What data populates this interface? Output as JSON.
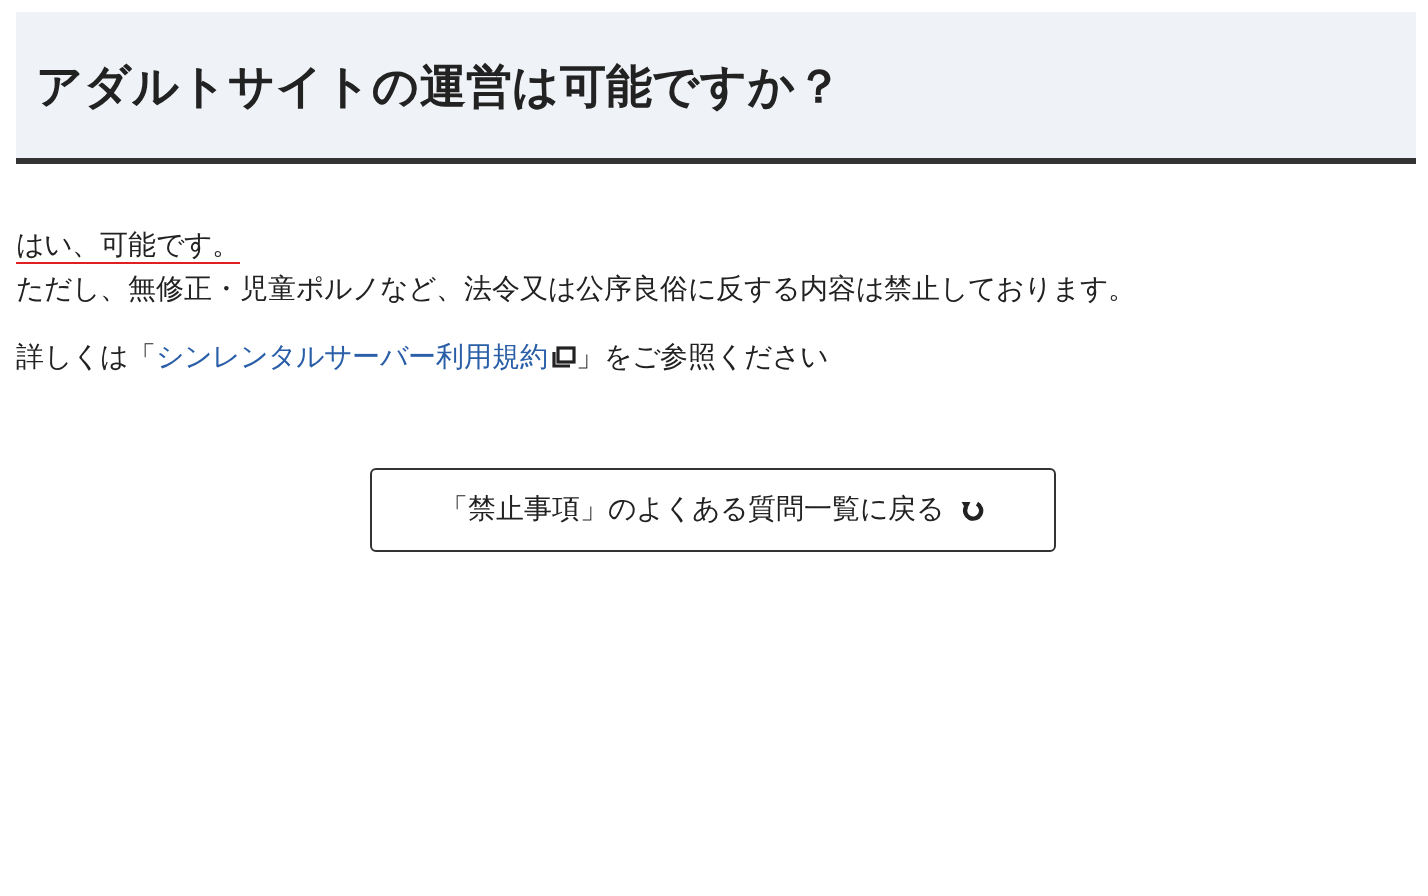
{
  "heading": "アダルトサイトの運営は可能ですか？",
  "answer_lines": [
    {
      "text": "はい、可能です。",
      "emphasized": true
    },
    {
      "text": "ただし、無修正・児童ポルノなど、法令又は公序良俗に反する内容は禁止しております。",
      "emphasized": false
    }
  ],
  "reference": {
    "before": "詳しくは「",
    "link": "シンレンタルサーバー利用規約",
    "after": "」をご参照ください"
  },
  "back_button": "「禁止事項」のよくある質問一覧に戻る"
}
